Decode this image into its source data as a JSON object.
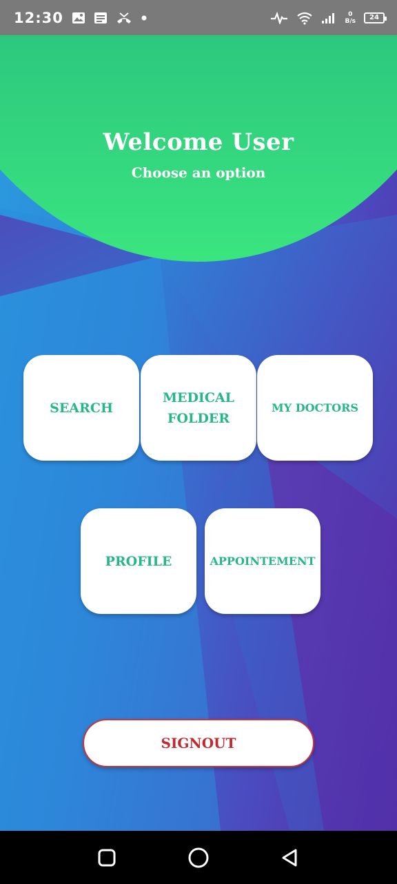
{
  "status_bar": {
    "time": "12:30",
    "speed_value": "0",
    "speed_unit": "B/s",
    "battery": "24",
    "icons": [
      "gallery-icon",
      "message-icon",
      "missed-call-icon",
      "dot-icon",
      "activity-icon",
      "wifi-icon",
      "signal-icon",
      "battery-icon"
    ]
  },
  "header": {
    "title": "Welcome User",
    "subtitle": "Choose an option"
  },
  "options": {
    "search": "SEARCH",
    "medical_folder": "MEDICAL FOLDER",
    "my_doctors": "MY DOCTORS",
    "profile": "PROFILE",
    "appointement": "APPOINTEMENT"
  },
  "signout": "SIGNOUT",
  "colors": {
    "header_top": "#1f9f8a",
    "header_bottom": "#3ae57f",
    "card_text": "#27b58a",
    "signout_text": "#c22a30",
    "background_left": "#2a9cdf",
    "background_right": "#5a2aa6"
  },
  "nav_bar": {
    "icons": [
      "recent-apps-icon",
      "home-icon",
      "back-icon"
    ]
  }
}
